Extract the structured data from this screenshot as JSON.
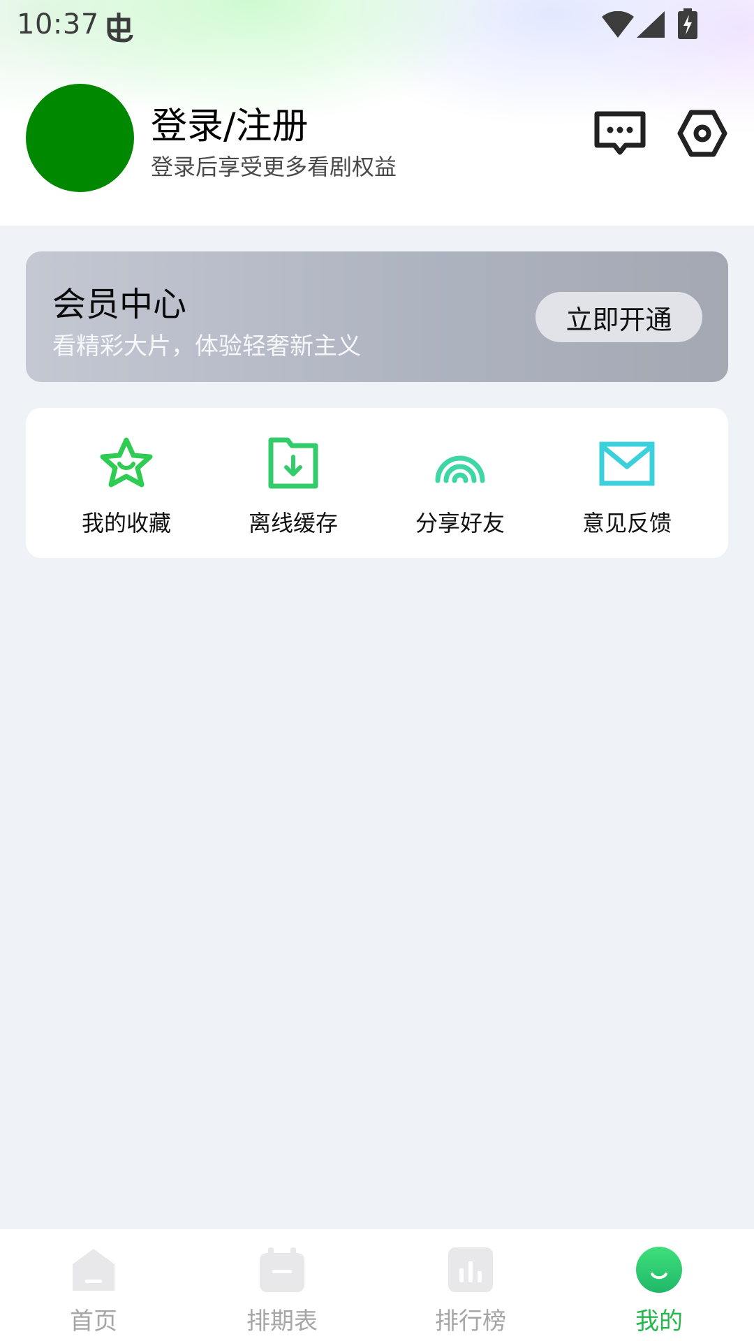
{
  "status_bar": {
    "time": "10:37",
    "icons": [
      "debug-bug-icon",
      "wifi-icon",
      "cell-signal-icon",
      "battery-charging-icon"
    ]
  },
  "header": {
    "login_title": "登录/注册",
    "login_subtitle": "登录后享受更多看剧权益",
    "avatar_color": "#008800",
    "actions": [
      "message-icon",
      "settings-icon"
    ]
  },
  "vip": {
    "title": "会员中心",
    "description": "看精彩大片，体验轻奢新主义",
    "button_label": "立即开通"
  },
  "quick_actions": [
    {
      "label": "我的收藏",
      "icon": "star-icon"
    },
    {
      "label": "离线缓存",
      "icon": "download-folder-icon"
    },
    {
      "label": "分享好友",
      "icon": "share-signal-icon"
    },
    {
      "label": "意见反馈",
      "icon": "mail-icon"
    }
  ],
  "tabs": [
    {
      "label": "首页",
      "icon": "home-icon",
      "active": false
    },
    {
      "label": "排期表",
      "icon": "calendar-icon",
      "active": false
    },
    {
      "label": "排行榜",
      "icon": "ranking-icon",
      "active": false
    },
    {
      "label": "我的",
      "icon": "profile-smile-icon",
      "active": true
    }
  ],
  "colors": {
    "accent_green": "#22b84a",
    "tab_inactive": "#a6a6a6",
    "page_background": "#eff3f8"
  }
}
